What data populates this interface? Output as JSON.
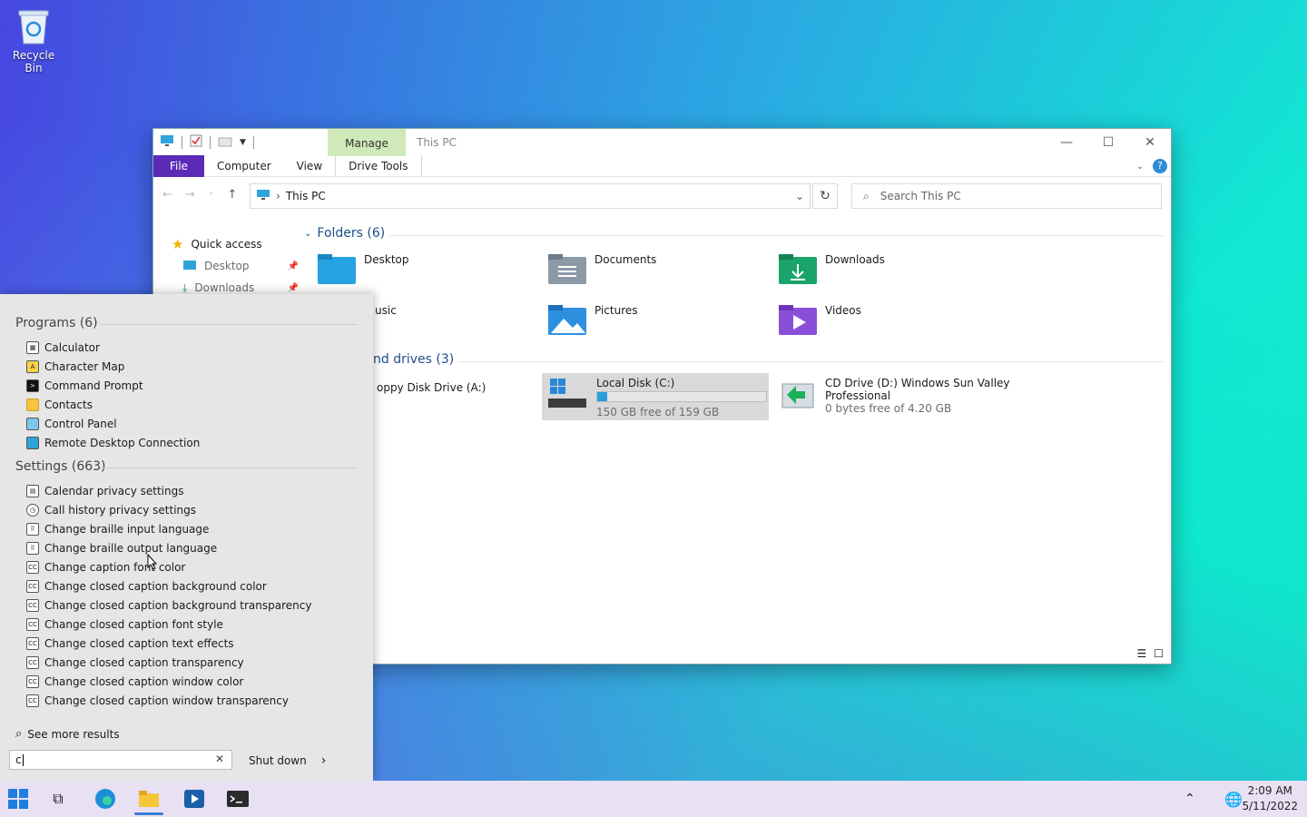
{
  "desktop": {
    "recycle_bin_label": "Recycle Bin"
  },
  "explorer": {
    "title": "This PC",
    "manage_tab": "Manage",
    "tabs": {
      "file": "File",
      "computer": "Computer",
      "view": "View",
      "drive_tools": "Drive Tools"
    },
    "help_label": "?",
    "address": "This PC",
    "search_placeholder": "Search This PC",
    "nav": {
      "quick_access": "Quick access",
      "desktop": "Desktop",
      "downloads": "Downloads"
    },
    "folders_header": "Folders (6)",
    "folders": {
      "desktop": "Desktop",
      "documents": "Documents",
      "downloads": "Downloads",
      "music": "usic",
      "pictures": "Pictures",
      "videos": "Videos"
    },
    "drives_header": "nd drives (3)",
    "drives": {
      "floppy": "oppy Disk Drive (A:)",
      "c_name": "Local Disk (C:)",
      "c_free": "150 GB free of 159 GB",
      "c_used_fraction": 0.06,
      "d_name_line1": "CD Drive (D:) Windows Sun Valley",
      "d_name_line2": "Professional",
      "d_free": "0 bytes free of 4.20 GB"
    }
  },
  "start_search": {
    "programs_header": "Programs (6)",
    "programs": [
      "Calculator",
      "Character Map",
      "Command Prompt",
      "Contacts",
      "Control Panel",
      "Remote Desktop Connection"
    ],
    "settings_header": "Settings (663)",
    "settings": [
      "Calendar privacy settings",
      "Call history privacy settings",
      "Change braille input language",
      "Change braille output language",
      "Change caption font color",
      "Change closed caption background color",
      "Change closed caption background transparency",
      "Change closed caption font style",
      "Change closed caption text effects",
      "Change closed caption transparency",
      "Change closed caption window color",
      "Change closed caption window transparency"
    ],
    "see_more": "See more results",
    "query": "c",
    "shutdown_label": "Shut down"
  },
  "taskbar": {
    "time": "2:09 AM",
    "date": "5/11/2022"
  }
}
